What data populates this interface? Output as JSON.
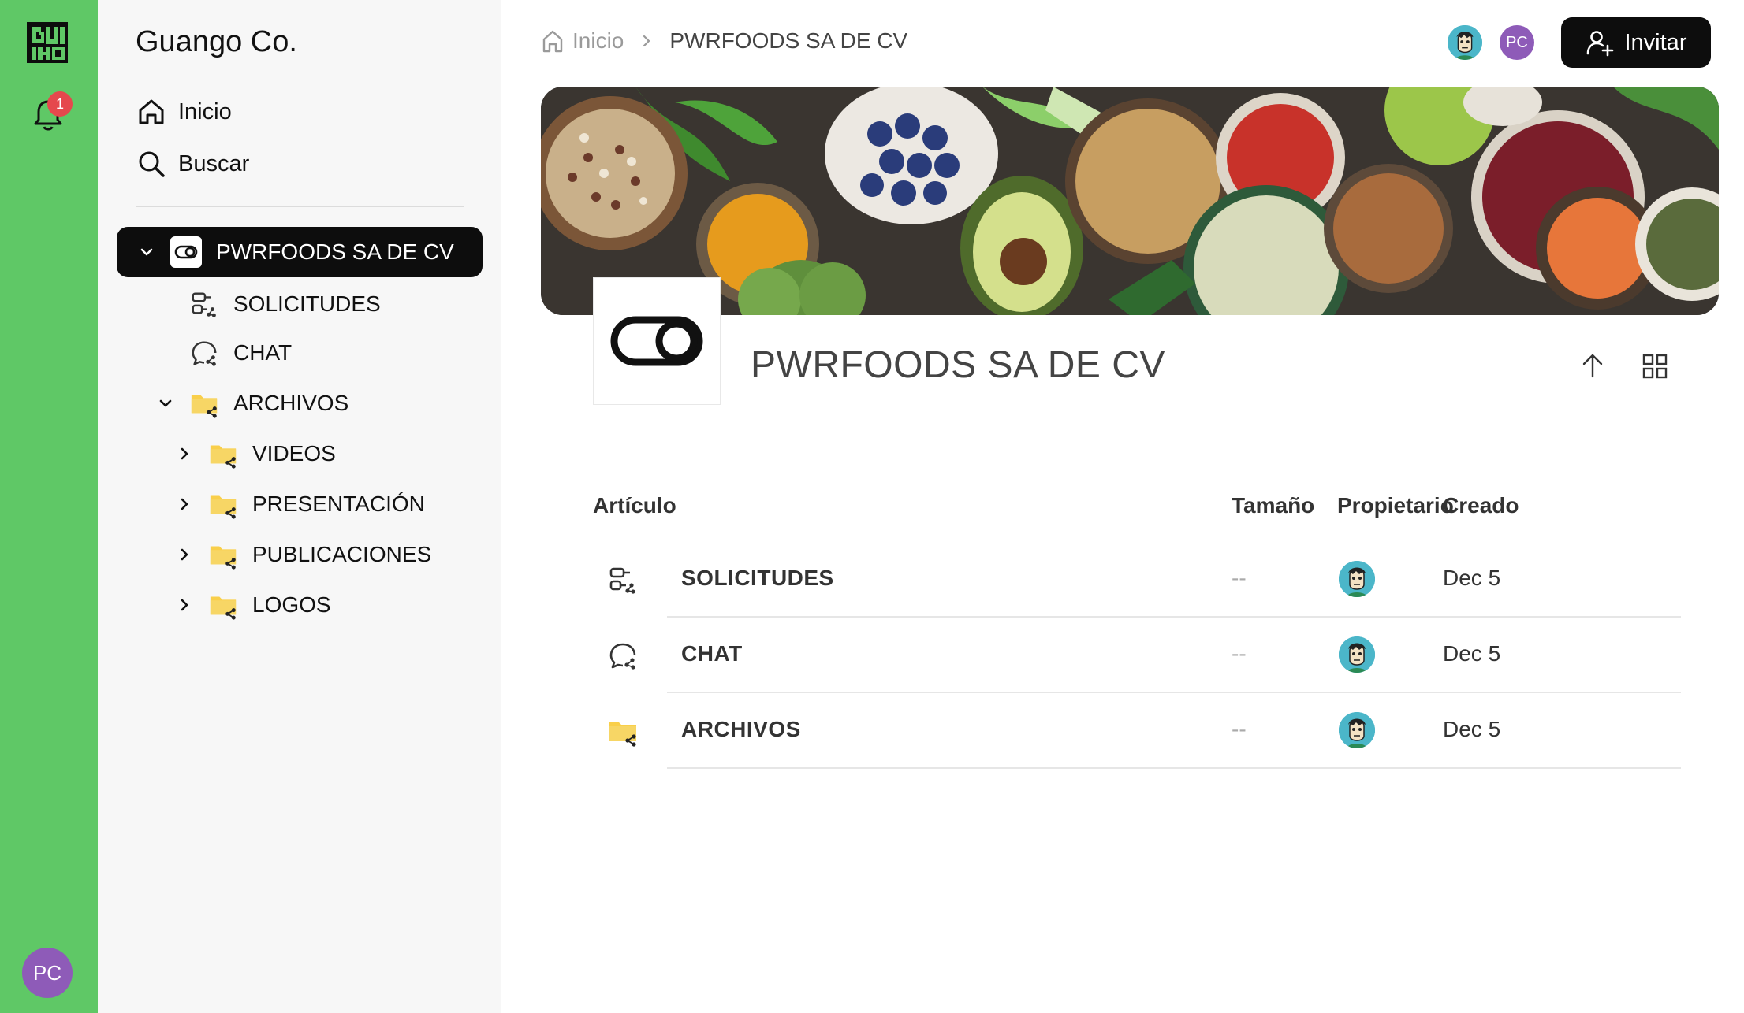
{
  "rail": {
    "notifications": "1",
    "user_initials": "PC"
  },
  "sidebar": {
    "org_name": "Guango Co.",
    "nav": [
      {
        "label": "Inicio",
        "icon": "home-icon"
      },
      {
        "label": "Buscar",
        "icon": "search-icon"
      }
    ],
    "space": {
      "label": "PWRFOODS SA DE CV"
    },
    "tree": [
      {
        "label": "SOLICITUDES",
        "icon": "requests-icon"
      },
      {
        "label": "CHAT",
        "icon": "chat-icon"
      },
      {
        "label": "ARCHIVOS",
        "icon": "shared-folder-icon"
      },
      {
        "label": "VIDEOS",
        "icon": "shared-folder-icon"
      },
      {
        "label": "PRESENTACIÓN",
        "icon": "shared-folder-icon"
      },
      {
        "label": "PUBLICACIONES",
        "icon": "shared-folder-icon"
      },
      {
        "label": "LOGOS",
        "icon": "shared-folder-icon"
      }
    ]
  },
  "breadcrumb": {
    "home": "Inicio",
    "current": "PWRFOODS SA DE CV"
  },
  "header": {
    "members_initials": "PC",
    "invite_label": "Invitar"
  },
  "space": {
    "title": "PWRFOODS SA DE CV"
  },
  "table": {
    "columns": {
      "article": "Artículo",
      "size": "Tamaño",
      "owner": "Propietario",
      "created": "Creado"
    },
    "rows": [
      {
        "name": "SOLICITUDES",
        "size": "--",
        "created": "Dec 5",
        "icon": "requests-icon"
      },
      {
        "name": "CHAT",
        "size": "--",
        "created": "Dec 5",
        "icon": "chat-icon"
      },
      {
        "name": "ARCHIVOS",
        "size": "--",
        "created": "Dec 5",
        "icon": "shared-folder-icon"
      }
    ]
  },
  "colors": {
    "rail": "#5fc866",
    "dark": "#0d0d0d",
    "folder": "#f9cf4a",
    "badge": "#e5484d",
    "avatar_pc": "#8e5bb8",
    "avatar_face": "#4bb6c9"
  }
}
